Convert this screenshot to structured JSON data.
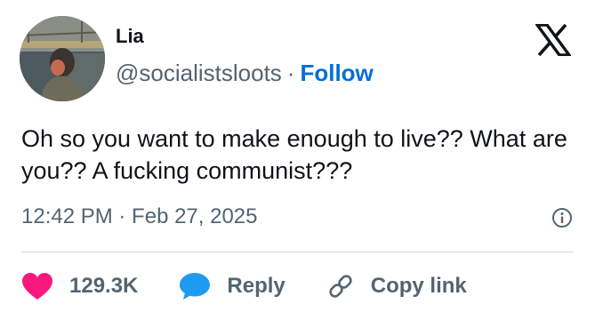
{
  "author": {
    "display_name": "Lia",
    "handle": "@socialistsloots",
    "separator": "·",
    "follow_label": "Follow"
  },
  "tweet": {
    "text": "Oh so you want to make enough to live?? What are you?? A fucking communist???",
    "timestamp": "12:42 PM · Feb 27, 2025"
  },
  "actions": {
    "like_count": "129.3K",
    "reply_label": "Reply",
    "copy_link_label": "Copy link"
  },
  "icons": {
    "brand": "x-logo-icon",
    "info": "info-icon",
    "like": "heart-icon",
    "reply": "speech-bubble-icon",
    "copy_link": "link-icon"
  },
  "colors": {
    "text": "#0f1419",
    "secondary": "#536471",
    "follow": "#006fd6",
    "like": "#f91880",
    "reply": "#1d9bf0",
    "divider": "#cfd9de"
  }
}
